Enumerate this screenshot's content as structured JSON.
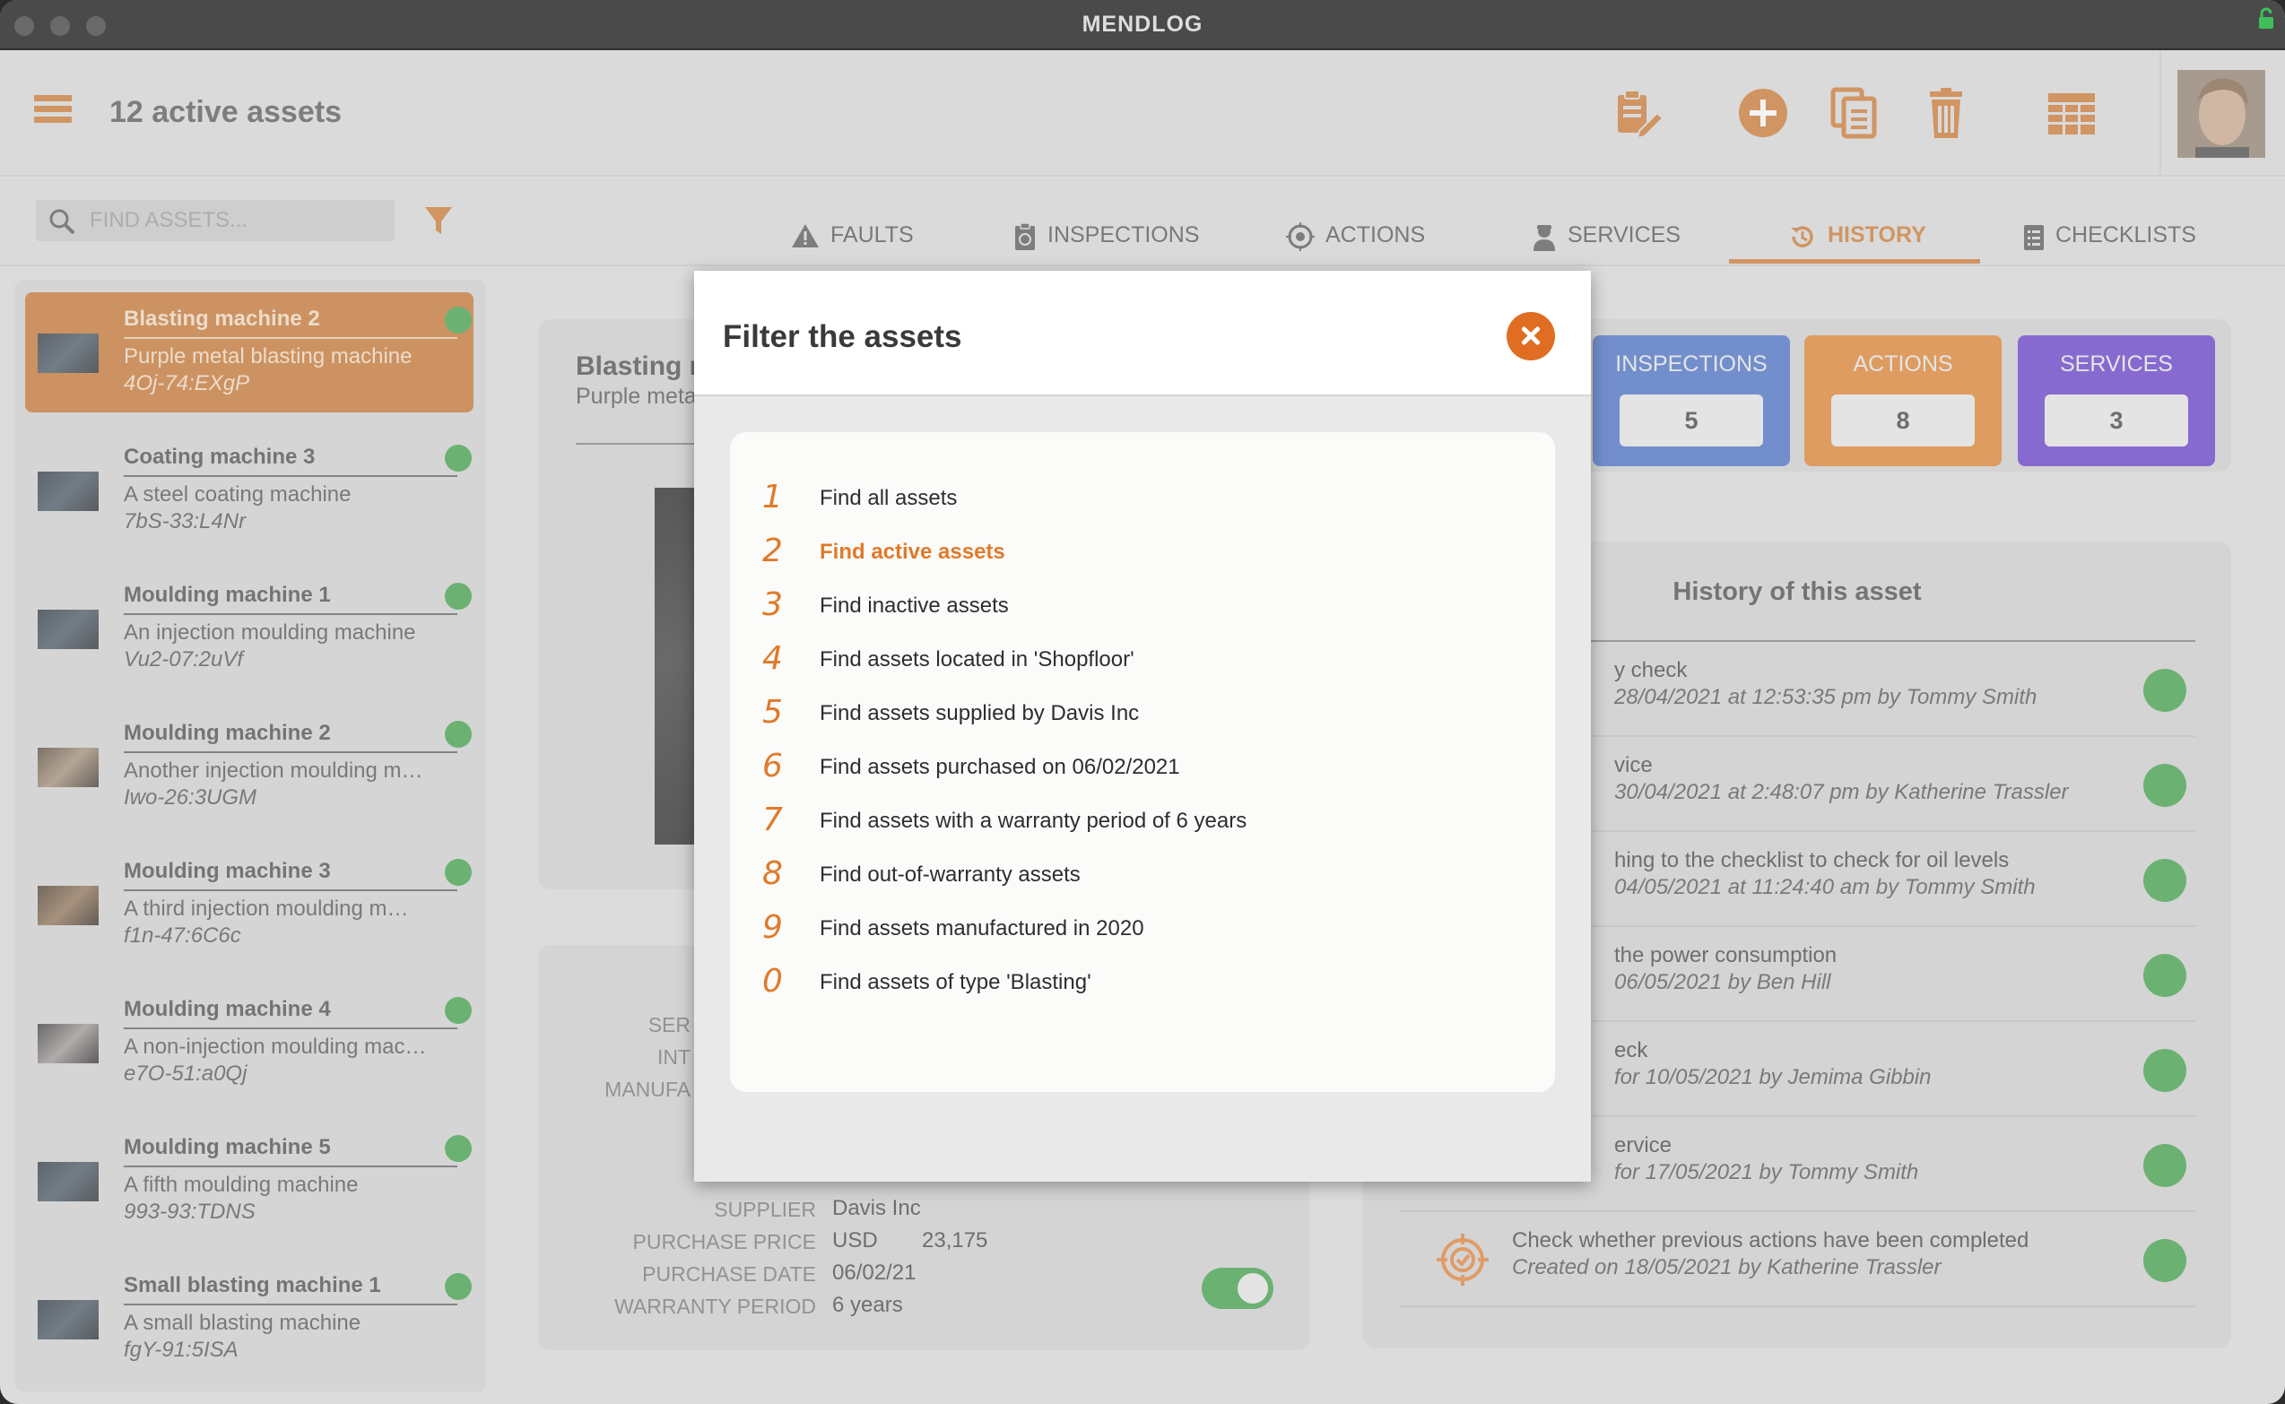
{
  "window": {
    "title": "MENDLOG"
  },
  "header": {
    "title": "12 active assets"
  },
  "search": {
    "placeholder": "FIND ASSETS..."
  },
  "tabs": [
    {
      "label": "FAULTS",
      "icon": "warning-icon"
    },
    {
      "label": "INSPECTIONS",
      "icon": "clipboard-timer-icon"
    },
    {
      "label": "ACTIONS",
      "icon": "target-icon"
    },
    {
      "label": "SERVICES",
      "icon": "worker-icon"
    },
    {
      "label": "HISTORY",
      "icon": "history-icon",
      "active": true
    },
    {
      "label": "CHECKLISTS",
      "icon": "checklist-icon"
    }
  ],
  "assets": [
    {
      "name": "Blasting machine 2",
      "desc": "Purple metal blasting machine",
      "code": "4Oj-74:EXgP",
      "selected": true
    },
    {
      "name": "Coating machine 3",
      "desc": "A steel coating machine",
      "code": "7bS-33:L4Nr"
    },
    {
      "name": "Moulding machine 1",
      "desc": "An injection moulding machine",
      "code": "Vu2-07:2uVf"
    },
    {
      "name": "Moulding machine 2",
      "desc": "Another injection moulding m…",
      "code": "Iwo-26:3UGM"
    },
    {
      "name": "Moulding machine 3",
      "desc": "A third injection moulding m…",
      "code": "f1n-47:6C6c"
    },
    {
      "name": "Moulding machine 4",
      "desc": "A non-injection moulding mac…",
      "code": "e7O-51:a0Qj"
    },
    {
      "name": "Moulding machine 5",
      "desc": "A fifth moulding machine",
      "code": "993-93:TDNS"
    },
    {
      "name": "Small blasting machine 1",
      "desc": "A small blasting machine",
      "code": "fgY-91:5ISA"
    }
  ],
  "detail": {
    "title": "Blasting m",
    "subtitle": "Purple meta",
    "labels_partial": [
      "SER",
      "INT",
      "MANUFA"
    ],
    "supplier_label": "SUPPLIER",
    "supplier": "Davis Inc",
    "price_label": "PURCHASE PRICE",
    "price_currency": "USD",
    "price": "23,175",
    "date_label": "PURCHASE DATE",
    "date": "06/02/21",
    "warranty_label": "WARRANTY PERIOD",
    "warranty": "6 years"
  },
  "stats": [
    {
      "label": "INSPECTIONS",
      "value": "5",
      "color": "#3a64c4"
    },
    {
      "label": "ACTIONS",
      "value": "8",
      "color": "#df7a1e"
    },
    {
      "label": "SERVICES",
      "value": "3",
      "color": "#5a2dc9"
    }
  ],
  "history": {
    "title": "History of this asset",
    "rows": [
      {
        "line1": "y check",
        "line2": "28/04/2021 at 12:53:35 pm by Tommy Smith"
      },
      {
        "line1": "vice",
        "line2": "30/04/2021 at 2:48:07 pm by Katherine Trassler"
      },
      {
        "line1": "hing to the checklist to check for oil levels",
        "line2": "04/05/2021 at 11:24:40 am by Tommy Smith"
      },
      {
        "line1": "the power consumption",
        "line2": "06/05/2021 by Ben Hill"
      },
      {
        "line1": "eck",
        "line2": "for 10/05/2021 by Jemima Gibbin"
      },
      {
        "line1": "ervice",
        "line2": "for 17/05/2021 by Tommy Smith"
      },
      {
        "line1": "Check whether previous actions have been completed",
        "line2": "Created on 18/05/2021 by Katherine Trassler"
      }
    ]
  },
  "modal": {
    "title": "Filter the assets",
    "options": [
      {
        "num": "1",
        "label": "Find all assets"
      },
      {
        "num": "2",
        "label": "Find active assets",
        "active": true
      },
      {
        "num": "3",
        "label": "Find inactive assets"
      },
      {
        "num": "4",
        "label": "Find assets located in 'Shopfloor'"
      },
      {
        "num": "5",
        "label": "Find assets supplied by Davis Inc"
      },
      {
        "num": "6",
        "label": "Find assets purchased on 06/02/2021"
      },
      {
        "num": "7",
        "label": "Find assets with a warranty period of 6 years"
      },
      {
        "num": "8",
        "label": "Find out-of-warranty assets"
      },
      {
        "num": "9",
        "label": "Find assets manufactured in 2020"
      },
      {
        "num": "0",
        "label": "Find assets of type 'Blasting'"
      }
    ]
  },
  "colors": {
    "accent": "#c96f22",
    "status_ok": "#2e9a3a"
  }
}
